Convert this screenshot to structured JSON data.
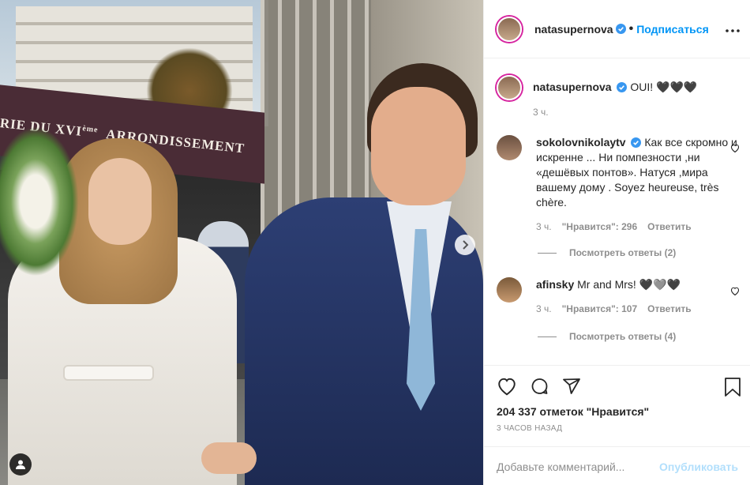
{
  "photo": {
    "sign_line1": "RIE DU XVI",
    "sign_sup": "ème",
    "sign_line2": "ARRONDISSEMENT"
  },
  "header": {
    "username": "natasupernova",
    "separator": "•",
    "follow_label": "Подписаться"
  },
  "caption": {
    "username": "natasupernova",
    "text": "OUI! 🖤🖤🖤",
    "time": "3 ч."
  },
  "comments": [
    {
      "username": "sokolovnikolaytv",
      "verified": true,
      "text": "Как все скромно и искренне ... Ни помпезности ,ни «дешёвых понтов». Натуся ,мира вашему дому . Soyez heureuse, très chère.",
      "time": "3 ч.",
      "likes": "\"Нравится\": 296",
      "reply_label": "Ответить",
      "view_replies": "Посмотреть ответы (2)"
    },
    {
      "username": "afinsky",
      "verified": false,
      "text": "Mr and Mrs! 🖤🩶🖤",
      "time": "3 ч.",
      "likes": "\"Нравится\": 107",
      "reply_label": "Ответить",
      "view_replies": "Посмотреть ответы (4)"
    }
  ],
  "actions": {
    "likes_text": "204 337 отметок \"Нравится\"",
    "posted_time": "3 ЧАСОВ НАЗАД"
  },
  "add_comment": {
    "placeholder": "Добавьте комментарий...",
    "publish_label": "Опубликовать"
  },
  "colors": {
    "accent": "#0095f6",
    "verified": "#3897f0",
    "publish_disabled": "#b2dffc"
  },
  "icons": [
    "next-arrow-icon",
    "user-tag-icon",
    "verified-icon",
    "more-icon",
    "heart-icon",
    "comment-icon",
    "share-icon",
    "bookmark-icon"
  ]
}
